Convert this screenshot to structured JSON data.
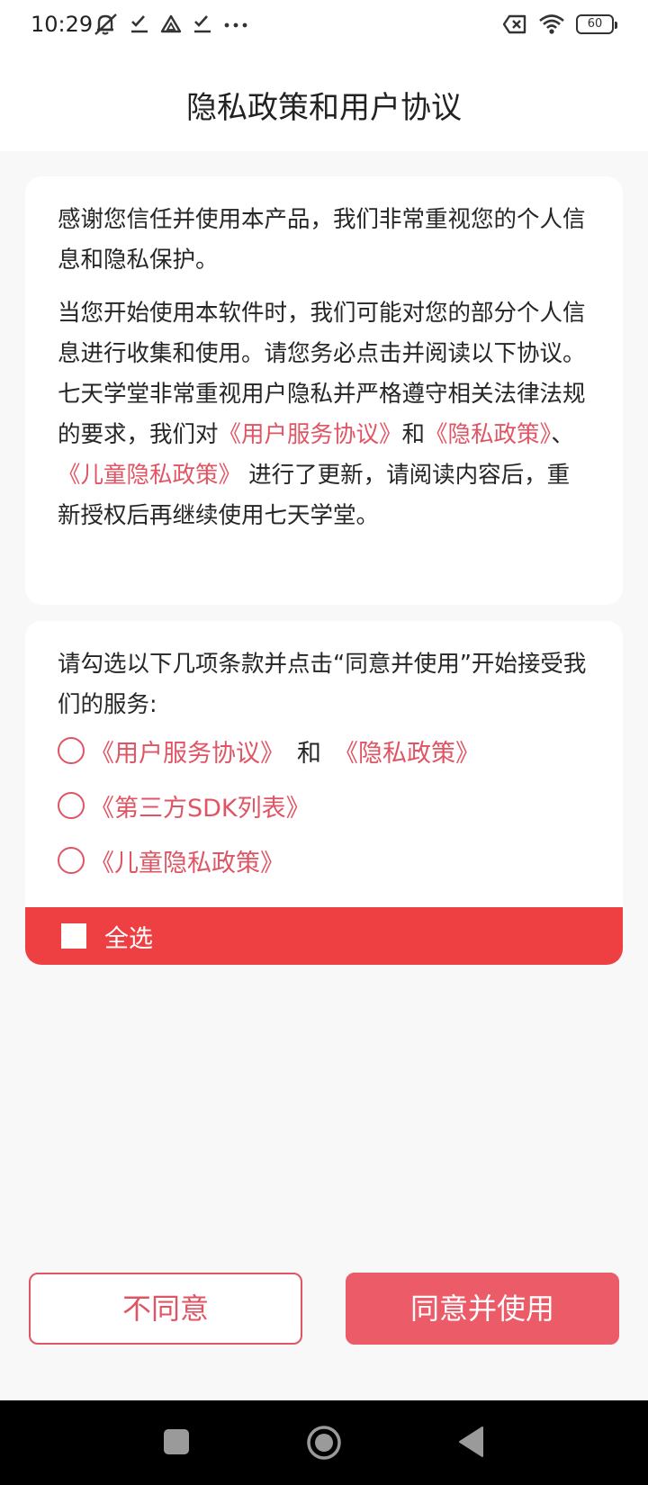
{
  "status_bar": {
    "time": "10:29",
    "battery": "60",
    "icons_left": [
      "mute-icon",
      "check-icon",
      "drive-icon",
      "check-icon",
      "more-icon"
    ],
    "icons_right": [
      "no-sim-icon",
      "wifi-icon",
      "battery-icon"
    ]
  },
  "header": {
    "title": "隐私政策和用户协议"
  },
  "intro": {
    "p1": "感谢您信任并使用本产品，我们非常重视您的个人信息和隐私保护。",
    "p2_before": "当您开始使用本软件时，我们可能对您的部分个人信息进行收集和使用。请您务必点击并阅读以下协议。 七天学堂非常重视用户隐私并严格遵守相关法律法规的要求，我们对",
    "link_user_agreement": "《用户服务协议》",
    "p2_and": "和",
    "link_privacy": "《隐私政策》",
    "p2_sep": "、",
    "link_child_privacy": "《儿童隐私政策》",
    "p2_after": " 进行了更新，请阅读内容后，重新授权后再继续使用七天学堂。"
  },
  "terms": {
    "intro": "请勾选以下几项条款并点击“同意并使用”开始接受我们的服务:",
    "items": [
      {
        "link1": "《用户服务协议》",
        "and": "和",
        "link2": "《隐私政策》",
        "checked": false
      },
      {
        "link1": "《第三方SDK列表》",
        "checked": false
      },
      {
        "link1": "《儿童隐私政策》",
        "checked": false
      }
    ],
    "select_all": "全选"
  },
  "buttons": {
    "disagree": "不同意",
    "agree": "同意并使用"
  },
  "colors": {
    "accent": "#e05564",
    "select_all_bg": "#ee3f42",
    "agree_bg": "#ec5b68"
  }
}
